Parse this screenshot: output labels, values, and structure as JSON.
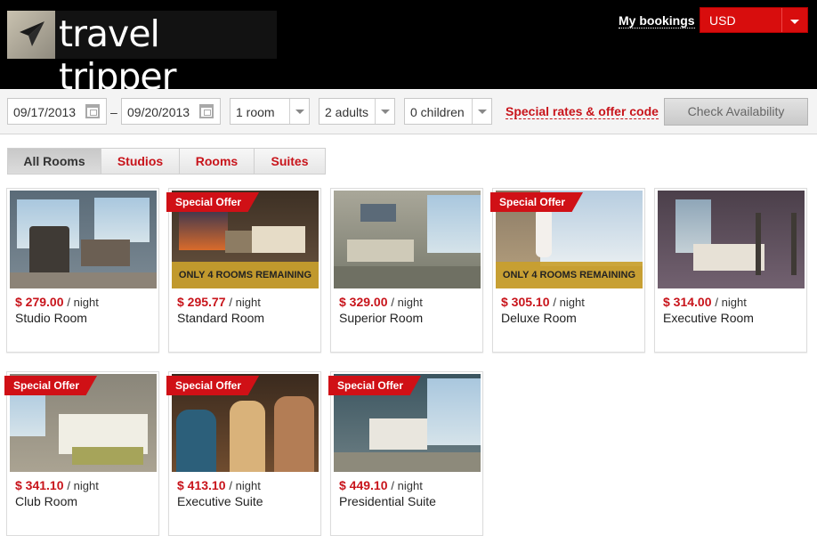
{
  "brand": {
    "name": "travel tripper"
  },
  "header": {
    "my_bookings": "My bookings",
    "currency": "USD"
  },
  "search": {
    "checkin": "09/17/2013",
    "separator": "–",
    "checkout": "09/20/2013",
    "rooms": "1 room",
    "adults": "2 adults",
    "children": "0 children",
    "special_link": "Special rates & offer code",
    "check_button": "Check Availability"
  },
  "tabs": [
    {
      "label": "All Rooms"
    },
    {
      "label": "Studios"
    },
    {
      "label": "Rooms"
    },
    {
      "label": "Suites"
    }
  ],
  "per_night": "/ night",
  "badge_text": "Special Offer",
  "remaining_text": "ONLY 4 ROOMS REMAINING",
  "rooms": [
    {
      "price": "$ 279.00",
      "name": "Studio Room"
    },
    {
      "price": "$ 295.77",
      "name": "Standard Room",
      "badge": "Special Offer",
      "remaining": "ONLY 4 ROOMS REMAINING"
    },
    {
      "price": "$ 329.00",
      "name": "Superior Room"
    },
    {
      "price": "$ 305.10",
      "name": "Deluxe Room",
      "badge": "Special Offer",
      "remaining": "ONLY 4 ROOMS REMAINING"
    },
    {
      "price": "$ 314.00",
      "name": "Executive Room"
    },
    {
      "price": "$ 341.10",
      "name": "Club Room",
      "badge": "Special Offer"
    },
    {
      "price": "$ 413.10",
      "name": "Executive Suite",
      "badge": "Special Offer"
    },
    {
      "price": "$ 449.10",
      "name": "Presidential Suite",
      "badge": "Special Offer"
    }
  ],
  "colors": {
    "accent": "#c8141b",
    "header_bg": "#000000",
    "remaining_bar": "#c9a02c"
  }
}
